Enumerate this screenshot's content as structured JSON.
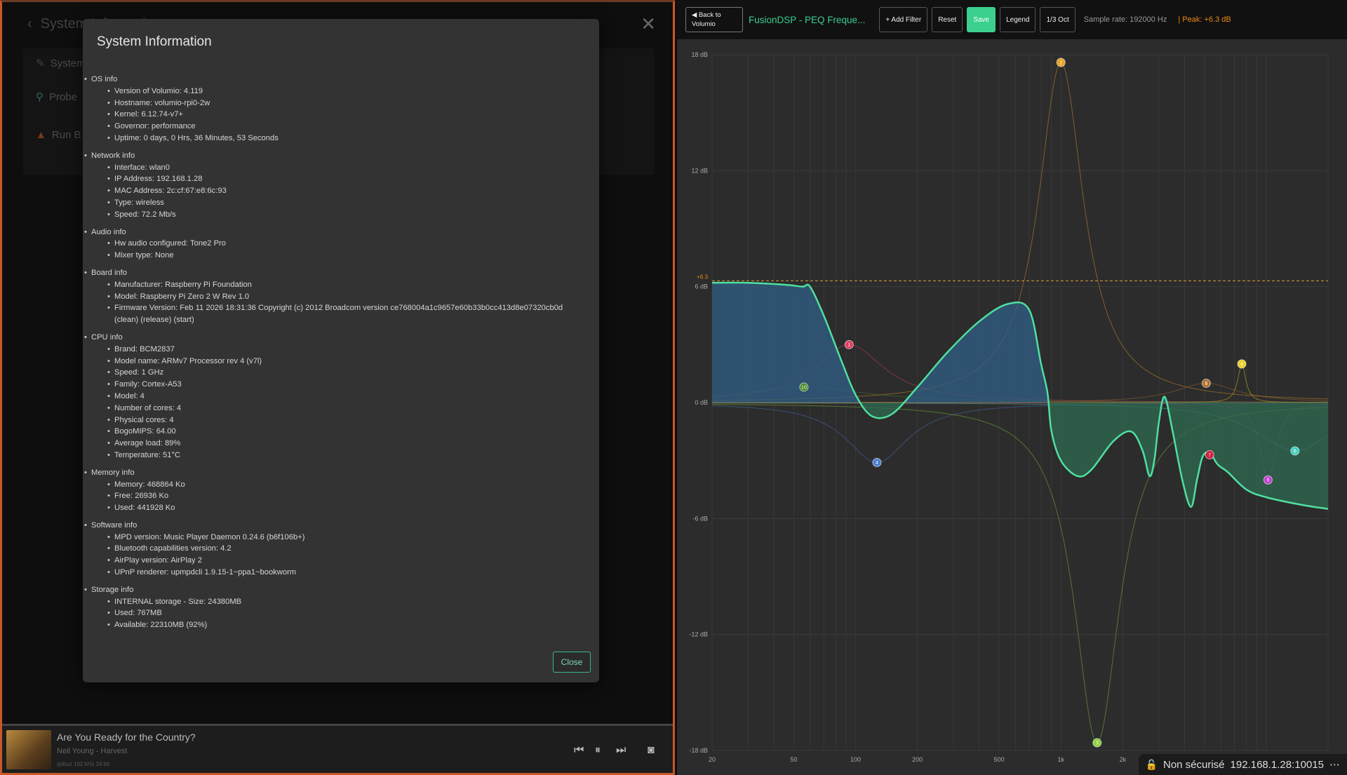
{
  "left": {
    "bg_title": "System Information",
    "bg_items": [
      "System",
      "Probe",
      "Run B"
    ],
    "modal": {
      "title": "System Information",
      "sections": [
        {
          "title": "OS info",
          "items": [
            "Version of Volumio: 4.119",
            "Hostname: volumio-rpi0-2w",
            "Kernel: 6.12.74-v7+",
            "Governor: performance",
            "Uptime: 0 days, 0 Hrs, 36 Minutes, 53 Seconds"
          ]
        },
        {
          "title": "Network info",
          "items": [
            "Interface: wlan0",
            "IP Address: 192.168.1.28",
            "MAC Address: 2c:cf:67:e8:6c:93",
            "Type: wireless",
            "Speed: 72.2 Mb/s"
          ]
        },
        {
          "title": "Audio info",
          "items": [
            "Hw audio configured: Tone2 Pro",
            "Mixer type: None"
          ]
        },
        {
          "title": "Board info",
          "items": [
            "Manufacturer: Raspberry Pi Foundation",
            "Model: Raspberry Pi Zero 2 W Rev 1.0",
            "Firmware Version: Feb 11 2026 18:31:36 Copyright (c) 2012 Broadcom version ce768004a1c9657e60b33b0cc413d8e07320cb0d (clean) (release) (start)"
          ]
        },
        {
          "title": "CPU info",
          "items": [
            "Brand: BCM2837",
            "Model name: ARMv7 Processor rev 4 (v7l)",
            "Speed: 1 GHz",
            "Family: Cortex-A53",
            "Model: 4",
            "Number of cores: 4",
            "Physical cores: 4",
            "BogoMIPS: 64.00",
            "Average load: 89%",
            "Temperature: 51°C"
          ]
        },
        {
          "title": "Memory info",
          "items": [
            "Memory: 468864 Ko",
            "Free: 26936 Ko",
            "Used: 441928 Ko"
          ]
        },
        {
          "title": "Software info",
          "items": [
            "MPD version: Music Player Daemon 0.24.6 (b6f106b+)",
            "Bluetooth capabilities version: 4.2",
            "AirPlay version: AirPlay 2",
            "UPnP renderer: upmpdcli 1.9.15-1~ppa1~bookworm"
          ]
        },
        {
          "title": "Storage info",
          "items": [
            "INTERNAL storage - Size: 24380MB",
            "Used: 767MB",
            "Available: 22310MB (92%)"
          ]
        }
      ],
      "close_label": "Close"
    },
    "player": {
      "title": "Are You Ready for the Country?",
      "artist": "Neil Young - Harvest",
      "meta": "qobuz   192 kHz 24 bit"
    }
  },
  "right": {
    "toolbar": {
      "back_label": "◀ Back to Volumio",
      "title": "FusionDSP - PEQ Freque...",
      "add_filter": "+ Add Filter",
      "reset": "Reset",
      "save": "Save",
      "legend": "Legend",
      "octave": "1/3 Oct",
      "sample_rate": "Sample rate: 192000 Hz",
      "peak": "| Peak: +6.3 dB"
    },
    "status": {
      "security": "Non sécurisé",
      "address": "192.168.1.28:10015",
      "more": "⋯"
    },
    "accent_color": "#3ccf8e",
    "peak_color": "#e88b1a"
  },
  "chart_data": {
    "type": "line",
    "title": "",
    "xlabel": "",
    "ylabel": "",
    "xscale": "log",
    "xlim": [
      20,
      20000
    ],
    "ylim": [
      -18,
      18
    ],
    "x_ticks": [
      20,
      50,
      100,
      200,
      500,
      1000,
      2000
    ],
    "x_tick_labels": [
      "20",
      "50",
      "100",
      "200",
      "500",
      "1k",
      "2k"
    ],
    "y_ticks": [
      18,
      12,
      6,
      0,
      -6,
      -12,
      -18
    ],
    "y_tick_labels": [
      "18 dB",
      "12 dB",
      "6 dB",
      "0 dB",
      "-6 dB",
      "-12 dB",
      "-18 dB"
    ],
    "peak_line": {
      "value": 6.3,
      "label": "+6.3"
    },
    "combined_response": {
      "name": "",
      "x": [
        20,
        30,
        45,
        55,
        60,
        70,
        85,
        100,
        120,
        150,
        200,
        280,
        400,
        550,
        700,
        800,
        860,
        900,
        1000,
        1200,
        1400,
        1800,
        2200,
        2500,
        2700,
        2850,
        3000,
        3200,
        3500,
        3900,
        4300,
        4600,
        4900,
        5300,
        5800,
        6500,
        8000,
        10000,
        15000,
        20000
      ],
      "y": [
        6.2,
        6.2,
        6.1,
        6.0,
        6.0,
        4.5,
        2.2,
        0.4,
        -0.7,
        -0.6,
        0.8,
        2.6,
        4.2,
        5.1,
        4.8,
        2.0,
        0.5,
        -1.5,
        -3.0,
        -3.8,
        -3.5,
        -2.0,
        -1.5,
        -2.5,
        -3.8,
        -3.0,
        -1.0,
        0.3,
        -1.5,
        -4.0,
        -5.4,
        -4.0,
        -2.8,
        -2.6,
        -3.2,
        -3.6,
        -4.5,
        -4.9,
        -5.3,
        -5.5
      ]
    },
    "filters": [
      {
        "id": "1",
        "freq": 93,
        "gain": 3.0,
        "q": 0.9,
        "color": "#e04060"
      },
      {
        "id": "2",
        "freq": 1000,
        "gain": 17.6,
        "q": 1.4,
        "color": "#e8a020"
      },
      {
        "id": "3",
        "freq": 1500,
        "gain": -17.6,
        "q": 1.4,
        "color": "#8ad03a"
      },
      {
        "id": "4",
        "freq": 127,
        "gain": -3.1,
        "q": 1.0,
        "color": "#4a7fd0"
      },
      {
        "id": "5",
        "freq": 10200,
        "gain": -4.0,
        "q": 4.0,
        "color": "#c040d0"
      },
      {
        "id": "6",
        "freq": 13800,
        "gain": -2.5,
        "q": 0.8,
        "color": "#40d0c0"
      },
      {
        "id": "7",
        "freq": 5300,
        "gain": -2.7,
        "q": 6.0,
        "color": "#d02040"
      },
      {
        "id": "8",
        "freq": 5100,
        "gain": 1.0,
        "q": 1.0,
        "color": "#b07030"
      },
      {
        "id": "9",
        "freq": 7600,
        "gain": 2.0,
        "q": 8.0,
        "color": "#e8d020"
      },
      {
        "id": "10",
        "freq": 56,
        "gain": 0.8,
        "q": 0.5,
        "color": "#4a8a2a"
      }
    ]
  }
}
